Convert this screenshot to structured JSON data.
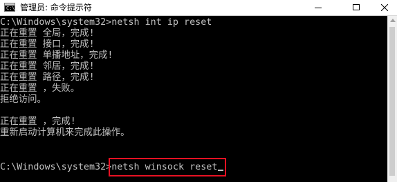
{
  "window": {
    "title": "管理员: 命令提示符",
    "icon_text": "C:\\_",
    "buttons": {
      "minimize": "minimize-icon",
      "maximize": "maximize-icon",
      "close": "close-icon"
    }
  },
  "console": {
    "lines": [
      "C:\\Windows\\system32>netsh int ip reset",
      "正在重置 全局，完成!",
      "正在重置 接口，完成!",
      "正在重置 单播地址，完成!",
      "正在重置 邻居，完成!",
      "正在重置 路径，完成!",
      "正在重置 ，失败。",
      "拒绝访问。",
      "",
      "正在重置 ，完成!",
      "重新启动计算机来完成此操作。",
      "",
      "",
      "C:\\Windows\\system32>netsh winsock reset"
    ],
    "text_color": "#c0c0c0",
    "background": "#000000",
    "highlight_color": "#e81123"
  }
}
